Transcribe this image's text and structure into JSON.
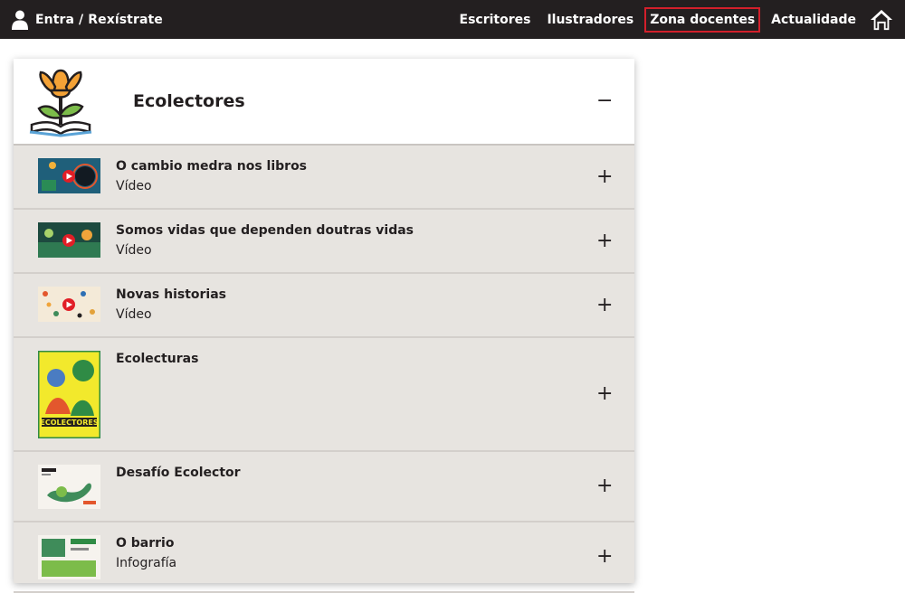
{
  "topbar": {
    "login_label": "Entra / Rexístrate",
    "nav": [
      {
        "label": "Escritores",
        "active": false
      },
      {
        "label": "Ilustradores",
        "active": false
      },
      {
        "label": "Zona docentes",
        "active": true
      },
      {
        "label": "Actualidade",
        "active": false
      }
    ],
    "active_border_color": "#d21f2b",
    "background": "#231f20"
  },
  "panel": {
    "title": "Ecolectores",
    "toggle": "−",
    "items": [
      {
        "title": "O cambio medra nos libros",
        "subtitle": "Vídeo",
        "toggle": "+"
      },
      {
        "title": "Somos vidas que dependen doutras vidas",
        "subtitle": "Vídeo",
        "toggle": "+"
      },
      {
        "title": "Novas historias",
        "subtitle": "Vídeo",
        "toggle": "+"
      },
      {
        "title": "Ecolecturas",
        "subtitle": "",
        "toggle": "+"
      },
      {
        "title": "Desafío Ecolector",
        "subtitle": "",
        "toggle": "+"
      },
      {
        "title": "O barrio",
        "subtitle": "Infografía",
        "toggle": "+"
      }
    ]
  },
  "thumbnails": {
    "cover_text": "ECOLECTORES"
  }
}
